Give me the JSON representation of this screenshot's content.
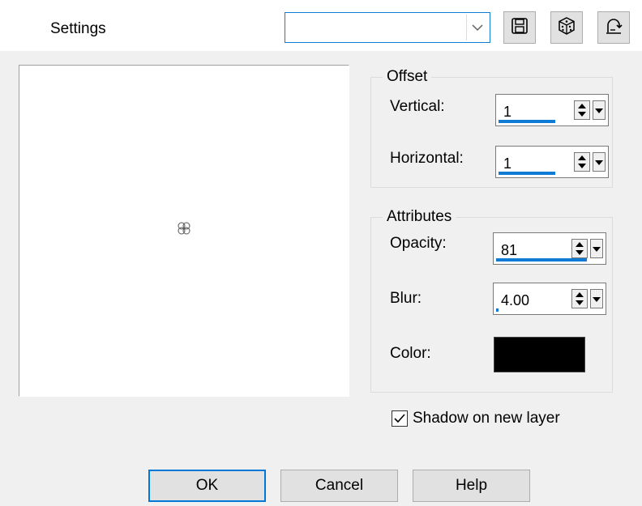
{
  "header": {
    "settings_label": "Settings",
    "preset_value": "",
    "tools": [
      {
        "icon": "save-icon"
      },
      {
        "icon": "dice-icon"
      },
      {
        "icon": "reset-icon"
      }
    ]
  },
  "offset": {
    "title": "Offset",
    "vertical_label": "Vertical:",
    "vertical_value": "1",
    "horizontal_label": "Horizontal:",
    "horizontal_value": "1"
  },
  "attributes": {
    "title": "Attributes",
    "opacity_label": "Opacity:",
    "opacity_value": "81",
    "opacity_fraction": 0.81,
    "blur_label": "Blur:",
    "blur_value": "4.00",
    "color_label": "Color:",
    "color": "#000000"
  },
  "options": {
    "shadow_new_layer_label": "Shadow on new layer",
    "shadow_new_layer_checked": true
  },
  "buttons": {
    "ok": "OK",
    "cancel": "Cancel",
    "help": "Help"
  },
  "colors": {
    "accent": "#0f7bd5",
    "background": "#f0f0f0"
  }
}
